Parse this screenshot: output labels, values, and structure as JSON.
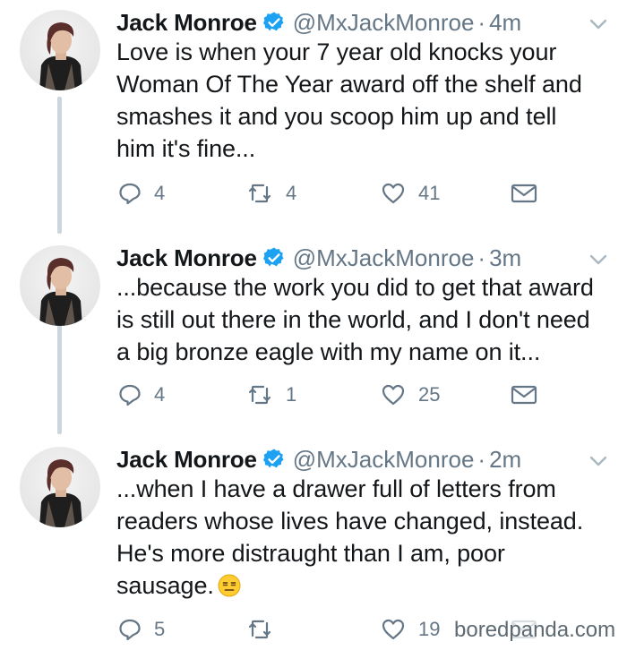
{
  "tweets": [
    {
      "name": "Jack Monroe",
      "handle": "@MxJackMonroe",
      "separator": "·",
      "time": "4m",
      "text": "Love is when your 7 year old knocks your\nWoman Of The Year award off the shelf and\nsmashes it and you scoop him up and tell\nhim it's fine...",
      "replies": "4",
      "retweets": "4",
      "likes": "41"
    },
    {
      "name": "Jack Monroe",
      "handle": "@MxJackMonroe",
      "separator": "·",
      "time": "3m",
      "text": "...because the work you did to get that award\nis still out there in the world, and I don't need\na big bronze eagle with my name on it...",
      "replies": "4",
      "retweets": "1",
      "likes": "25"
    },
    {
      "name": "Jack Monroe",
      "handle": "@MxJackMonroe",
      "separator": "·",
      "time": "2m",
      "text": "...when I have a drawer full of letters from\nreaders whose lives have changed, instead.\nHe's more distraught than I am, poor\nsausage.",
      "replies": "5",
      "retweets": "",
      "likes": "19"
    }
  ],
  "icons": {
    "verified": "verified-badge-icon",
    "caret": "chevron-down-icon",
    "reply": "reply-icon",
    "retweet": "retweet-icon",
    "like": "heart-icon",
    "dm": "envelope-icon",
    "emoji": "expressionless-face-emoji"
  },
  "colors": {
    "text": "#14171a",
    "secondary": "#657786",
    "verified": "#1da1f2",
    "thread_line": "#ccd6dd"
  },
  "watermark": "boredpanda.com"
}
